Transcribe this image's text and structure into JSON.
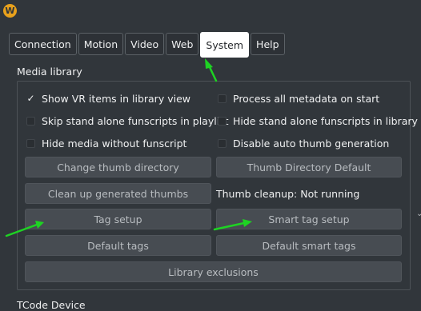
{
  "app": {
    "logo_letter": "W",
    "logo_color": "#e8a11c"
  },
  "tabs": [
    {
      "label": "Connection",
      "active": false
    },
    {
      "label": "Motion",
      "active": false
    },
    {
      "label": "Video",
      "active": false
    },
    {
      "label": "Web",
      "active": false
    },
    {
      "label": "System",
      "active": true
    },
    {
      "label": "Help",
      "active": false
    }
  ],
  "media_library": {
    "title": "Media library",
    "checkboxes": [
      {
        "label": "Show VR items in library view",
        "checked": true
      },
      {
        "label": "Process all metadata on start",
        "checked": false
      },
      {
        "label": "Skip stand alone funscripts in playlist",
        "checked": false
      },
      {
        "label": "Hide stand alone funscripts in library",
        "checked": false
      },
      {
        "label": "Hide media without funscript",
        "checked": false
      },
      {
        "label": "Disable auto thumb generation",
        "checked": false
      }
    ],
    "buttons": {
      "change_thumb_directory": "Change thumb directory",
      "thumb_directory_default": "Thumb Directory Default",
      "clean_up_thumbs": "Clean up generated thumbs",
      "tag_setup": "Tag setup",
      "smart_tag_setup": "Smart tag setup",
      "default_tags": "Default tags",
      "default_smart_tags": "Default smart tags",
      "library_exclusions": "Library exclusions"
    },
    "thumb_cleanup_status": "Thumb cleanup: Not running"
  },
  "next_section": {
    "title": "TCode Device"
  },
  "annotation_color": "#1ed323"
}
